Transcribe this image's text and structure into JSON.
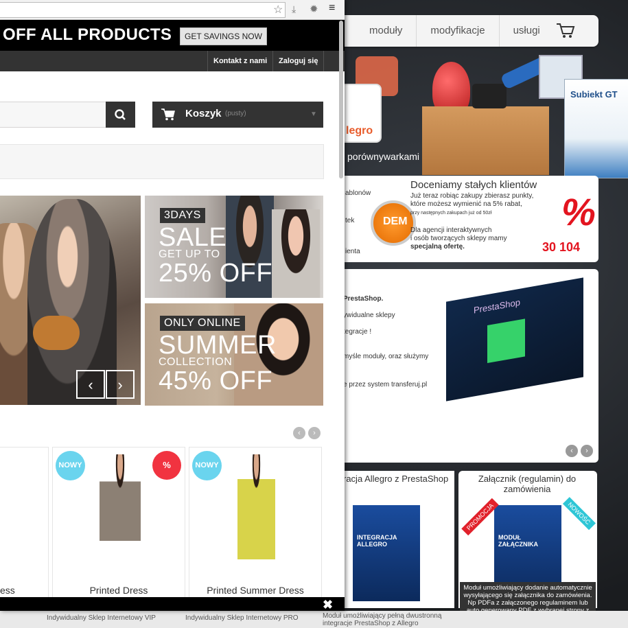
{
  "background_page": {
    "nav": [
      "moduły",
      "modyfikacje",
      "usługi"
    ],
    "hero_caption": "porównywarkami",
    "hero_brand_left": "legro",
    "subiekt_box": "Subiekt GT",
    "promo": {
      "side_items": [
        "ablonów",
        "tek",
        "ienta"
      ],
      "title": "Doceniamy stałych klientów",
      "line1": "Już teraz robiąc zakupy zbierasz punkty,",
      "line2": "które możesz wymienić na 5% rabat,",
      "line3": "przy następnych zakupach już od 50zł",
      "line4": "Dla agencji interaktywnych",
      "line5": "i osób tworzących sklepy mamy",
      "line6": "specjalną ofertę.",
      "demo": "DEM",
      "percent": "%",
      "numbers": "30 104"
    },
    "main_lines": [
      "PrestaShop.",
      "ywidualne sklepy",
      "tegracje !",
      "myśle moduły, oraz służymy",
      "e przez system transferuj.pl"
    ],
    "product_box_label": "PrestaShop",
    "products": [
      {
        "title": "racja Allegro z PrestaShop",
        "box": "INTEGRACJA ALLEGRO"
      },
      {
        "title": "Załącznik (regulamin) do zamówienia",
        "box": "MODUŁ ZAŁĄCZNIKA",
        "ribbon_left": "PROMOCJA",
        "ribbon_right": "NOWOŚĆ",
        "tooltip": "Moduł umożliwiający dodanie automatycznie wysyłającego się załącznika do zamówienia. Np PDFa z załączonego regulaminem lub auto generowany PDF z wybranej strony z CMS"
      }
    ],
    "footer": [
      "Indywidualny Sklep Internetowy VIP",
      "Indywidualny Sklep Internetowy PRO",
      "Moduł umożliwiający pełną dwustronną integracje PrestaShop z Allegro"
    ]
  },
  "window": {
    "banner_text": "OFF ALL PRODUCTS",
    "savings_button": "GET SAVINGS NOW",
    "toplinks": [
      "Kontakt z nami",
      "Zaloguj się"
    ],
    "cart_label": "Koszyk",
    "cart_status": "(pusty)",
    "banner1": {
      "tag": "3DAYS",
      "big1": "SALE",
      "small": "GET UP TO",
      "big2": "25% OFF"
    },
    "banner2": {
      "tag": "ONLY ONLINE",
      "big1": "SUMMER",
      "small": "COLLECTION",
      "big2": "45% OFF"
    },
    "products": [
      {
        "name": "ess"
      },
      {
        "name": "Printed Dress",
        "badge_new": "NOWY",
        "badge_sale": "%"
      },
      {
        "name": "Printed Summer Dress",
        "badge_new": "NOWY"
      }
    ],
    "close": "✖"
  }
}
